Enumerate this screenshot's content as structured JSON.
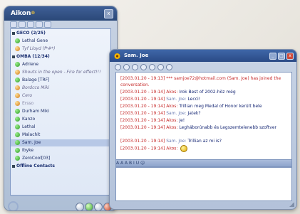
{
  "buddy_window": {
    "title": "Aikon",
    "title_sup": "®",
    "close_label": "x",
    "groups": [
      {
        "label": "GECO (2/25)",
        "contacts": [
          {
            "name": "Lethal Gene",
            "status": "online"
          },
          {
            "name": "Tyf Lloyd (f*#*)",
            "status": "idle"
          }
        ]
      },
      {
        "label": "OMBA (12/34)",
        "contacts": [
          {
            "name": "Adriene",
            "status": "online"
          },
          {
            "name": "Shouts in the open - Fire for effect!!!",
            "status": "idle"
          },
          {
            "name": "Balage [TRF]",
            "status": "online"
          },
          {
            "name": "Bordcco Miki",
            "status": "idle"
          },
          {
            "name": "Cero",
            "status": "idle"
          },
          {
            "name": "Ersso",
            "status": "away"
          },
          {
            "name": "Durham Miki",
            "status": "online"
          },
          {
            "name": "Kanzo",
            "status": "online"
          },
          {
            "name": "Lethal",
            "status": "online"
          },
          {
            "name": "Malachit",
            "status": "online"
          },
          {
            "name": "Sam. Joe",
            "status": "online",
            "selected": true
          },
          {
            "name": "Ibyke",
            "status": "online"
          },
          {
            "name": "ZeroCool[03]",
            "status": "online"
          }
        ]
      },
      {
        "label": "Offline Contacts",
        "contacts": []
      }
    ]
  },
  "chat_window": {
    "title": "Sam. Joe",
    "buttons": {
      "minimize": "_",
      "maximize": "□",
      "close": "x"
    },
    "messages": [
      {
        "time": "[2003.01.20 - 19:13]",
        "name": "",
        "text": "*** samjoe72@hotmail.com (Sam. Joe) has joined the conversation.",
        "kind": "system"
      },
      {
        "time": "[2003.01.20 - 19:14]",
        "name": "Akos:",
        "text": "Irok Best of 2002-höz még",
        "kind": "self"
      },
      {
        "time": "[2003.01.20 - 19:14]",
        "name": "Sam. Joe:",
        "text": "Lecci!",
        "kind": "other"
      },
      {
        "time": "[2003.01.20 - 19:14]",
        "name": "Akos:",
        "text": "Trillian meg Medal of Honor került bele",
        "kind": "self"
      },
      {
        "time": "[2003.01.20 - 19:14]",
        "name": "Sam. Joe:",
        "text": "Jatek?",
        "kind": "other"
      },
      {
        "time": "[2003.01.20 - 19:14]",
        "name": "Akos:",
        "text": "Je!",
        "kind": "self"
      },
      {
        "time": "[2003.01.20 - 19:14]",
        "name": "Akos:",
        "text": "Legháborúnabb és Legszemtelenebb szoftver",
        "kind": "self"
      },
      {
        "time": "[2003.01.20 - 19:14]",
        "name": "Sam. Joe:",
        "text": "Trillian az mi is?",
        "kind": "other"
      },
      {
        "time": "[2003.01.20 - 19:14]",
        "name": "Akos:",
        "text": "",
        "kind": "self",
        "smiley": true
      }
    ],
    "format_bar": "A  A  A  B  I  U  ☺",
    "input_value": ""
  }
}
